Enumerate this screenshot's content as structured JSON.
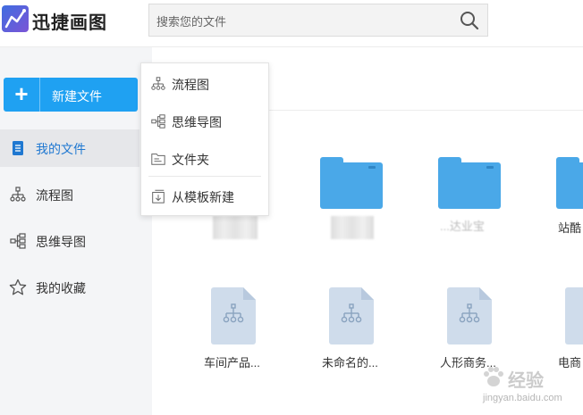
{
  "app": {
    "name": "迅捷画图"
  },
  "search": {
    "placeholder": "搜索您的文件"
  },
  "new_button": {
    "label": "新建文件",
    "plus": "+"
  },
  "sidebar": {
    "items": [
      {
        "label": "我的文件",
        "icon": "document-icon",
        "active": true
      },
      {
        "label": "流程图",
        "icon": "flowchart-icon",
        "active": false
      },
      {
        "label": "思维导图",
        "icon": "mindmap-icon",
        "active": false
      },
      {
        "label": "我的收藏",
        "icon": "star-icon",
        "active": false
      }
    ]
  },
  "dropdown": {
    "items": [
      {
        "label": "流程图",
        "icon": "flowchart-icon"
      },
      {
        "label": "思维导图",
        "icon": "mindmap-icon"
      },
      {
        "label": "文件夹",
        "icon": "folder-icon"
      },
      {
        "label": "从模板新建",
        "icon": "template-icon"
      }
    ]
  },
  "files": {
    "folders": [
      {
        "name": ""
      },
      {
        "name": ""
      },
      {
        "name": "...达业宝"
      },
      {
        "name": "站酷"
      }
    ],
    "documents": [
      {
        "name": "车间产品..."
      },
      {
        "name": "未命名的..."
      },
      {
        "name": "人形商务..."
      },
      {
        "name": "电商"
      }
    ]
  },
  "watermark": {
    "text": "经验",
    "url": "jingyan.baidu.com"
  },
  "colors": {
    "accent": "#1fa1f2",
    "folder": "#4aa8e8",
    "doc": "#cfdceb",
    "active_text": "#1f78d1"
  }
}
